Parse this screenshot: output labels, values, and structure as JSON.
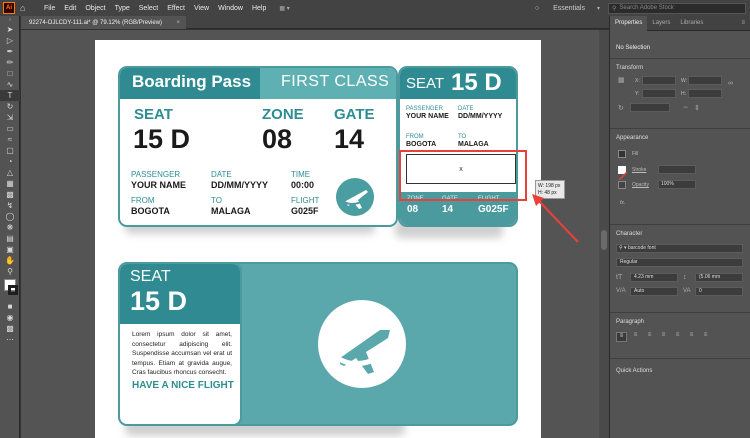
{
  "menubar": {
    "logo": "Ai",
    "items": [
      "File",
      "Edit",
      "Object",
      "Type",
      "Select",
      "Effect",
      "View",
      "Window",
      "Help"
    ],
    "workspace": "Essentials",
    "stock_placeholder": "Search Adobe Stock"
  },
  "document": {
    "tab_title": "92274-OJLCDY-111.ai* @ 79.12% (RGB/Preview)"
  },
  "pass_top": {
    "header_title": "Boarding Pass",
    "class_label": "FIRST CLASS",
    "seat_label": "SEAT",
    "seat_value": "15 D",
    "zone_label": "ZONE",
    "zone_value": "08",
    "gate_label": "GATE",
    "gate_value": "14",
    "passenger_label": "PASSENGER",
    "passenger_value": "YOUR NAME",
    "date_label": "DATE",
    "date_value": "DD/MM/YYYY",
    "time_label": "TIME",
    "time_value": "00:00",
    "from_label": "FROM",
    "from_value": "BOGOTA",
    "to_label": "TO",
    "to_value": "MALAGA",
    "flight_label": "FLIGHT",
    "flight_value": "G025F"
  },
  "stub": {
    "seat_label": "SEAT",
    "seat_value": "15 D",
    "passenger_label": "PASSENGER",
    "passenger_value": "YOUR NAME",
    "date_label": "DATE",
    "date_value": "DD/MM/YYYY",
    "from_label": "FROM",
    "from_value": "BOGOTA",
    "to_label": "TO",
    "to_value": "MALAGA",
    "barcode_mark": "x",
    "zone_label": "ZONE",
    "zone_value": "08",
    "gate_label": "GATE",
    "gate_value": "14",
    "flight_label": "FLIGHT",
    "flight_value": "G025F"
  },
  "tooltip": {
    "width": "W: 198 px",
    "height": "H: 48 px"
  },
  "pass_back": {
    "seat_label": "SEAT",
    "seat_value": "15 D",
    "body": "Lorem ipsum dolor sit amet, consectetur adipiscing elit. Suspendisse accumsan vel erat ut tempus. Etiam at gravida augue, Cras faucibus rhoncus consecht.",
    "slogan": "HAVE A NICE FLIGHT"
  },
  "panel": {
    "tabs": [
      "Properties",
      "Layers",
      "Libraries"
    ],
    "selection": "No Selection",
    "transform_title": "Transform",
    "labels": {
      "x": "X:",
      "y": "Y:",
      "w": "W:",
      "h": "H:"
    },
    "appearance_title": "Appearance",
    "fill_label": "Fill",
    "stroke_label": "Stroke",
    "opacity_label": "Opacity",
    "opacity_value": "100%",
    "fx_label": "fx.",
    "character_title": "Character",
    "font_family": "barcode font",
    "font_style": "Regular",
    "font_size": "4.23 mm",
    "leading": "(5.06 mm",
    "kerning": "Auto",
    "tracking": "0",
    "paragraph_title": "Paragraph",
    "quick_actions_title": "Quick Actions"
  },
  "colors": {
    "accent_teal": "#2e8d93",
    "highlight_red": "#e8413a"
  },
  "icons": [
    "home-icon",
    "lightbulb-icon",
    "search-icon",
    "plane-icon"
  ]
}
